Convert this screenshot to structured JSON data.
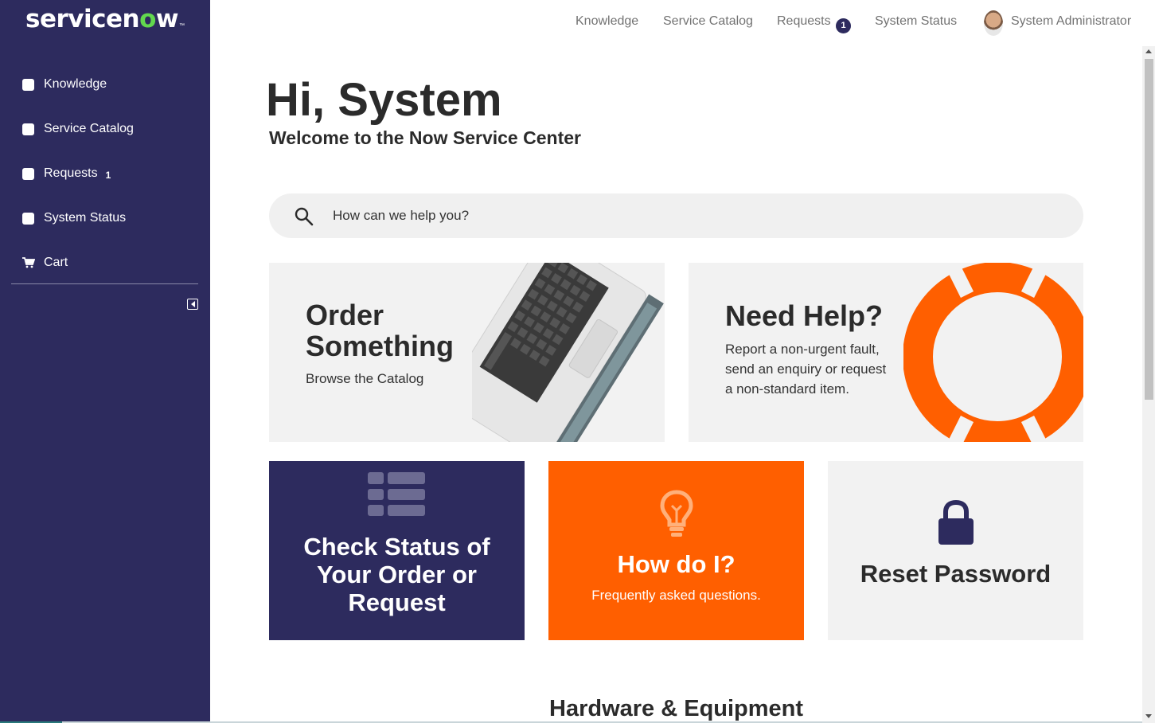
{
  "brand": {
    "logo_text_pre": "servicen",
    "logo_o": "o",
    "logo_text_post": "w",
    "trademark": "™"
  },
  "sidebar": {
    "items": [
      {
        "label": "Knowledge",
        "badge": ""
      },
      {
        "label": "Service Catalog",
        "badge": ""
      },
      {
        "label": "Requests",
        "badge": "1"
      },
      {
        "label": "System Status",
        "badge": ""
      },
      {
        "label": "Cart",
        "badge": ""
      }
    ]
  },
  "topnav": {
    "knowledge": "Knowledge",
    "service_catalog": "Service Catalog",
    "requests": "Requests",
    "requests_count": "1",
    "system_status": "System Status",
    "user_name": "System Administrator"
  },
  "hero": {
    "greeting": "Hi, System",
    "welcome": "Welcome to the Now Service Center"
  },
  "search": {
    "placeholder": "How can we help you?",
    "value": ""
  },
  "cards": {
    "order": {
      "title_line1": "Order",
      "title_line2": "Something",
      "subtitle": "Browse the Catalog"
    },
    "help": {
      "title": "Need Help?",
      "description": "Report a non-urgent fault, send an enquiry or request a non-standard item."
    },
    "status": {
      "title": "Check Status of Your Order or Request"
    },
    "howdo": {
      "title": "How do I?",
      "subtitle": "Frequently asked questions."
    },
    "reset": {
      "title": "Reset Password"
    }
  },
  "section": {
    "title": "Hardware & Equipment"
  },
  "colors": {
    "sidebar": "#2d2b5e",
    "accent_orange": "#ff5f00",
    "card_gray": "#f2f2f2"
  },
  "icons": [
    "checkbox-icon",
    "cart-icon",
    "collapse-icon",
    "search-icon",
    "laptop-image",
    "lifebuoy-icon",
    "list-icon",
    "lightbulb-icon",
    "lock-icon",
    "avatar"
  ]
}
